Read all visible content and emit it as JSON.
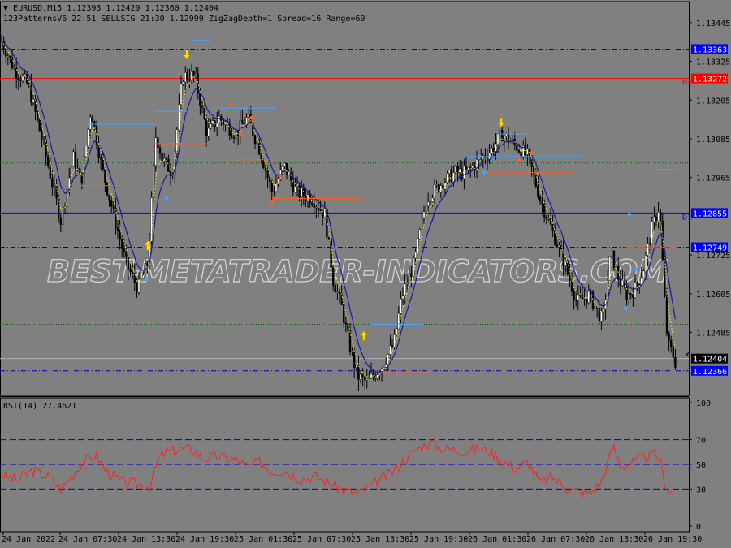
{
  "header": {
    "symbol_line": "EURUSD,M15  1.12393 1.12429 1.12360 1.12404",
    "indicator_line": "123PatternsV6  22:51  SELLSIG  21:30  1.12999  ZigZagDepth=1  Spread=16  Range=69"
  },
  "watermark": "BEST-METATRADER-INDICATORS.COM",
  "colors": {
    "background": "#808080",
    "bull_candle": "#ffffff",
    "bear_candle": "#000000",
    "rsi_line": "#ff2020",
    "ma_slow": "#1a1aa0",
    "ma_fast": "#f0e040",
    "level_blue": "#0000ff",
    "level_red": "#ff0000",
    "level_green": "#006000"
  },
  "price_axis": {
    "ticks": [
      "1.13445",
      "1.13325",
      "1.13205",
      "1.13085",
      "1.12965",
      "1.12725",
      "1.12605",
      "1.12485"
    ],
    "ymin": 1.1229,
    "ymax": 1.1351
  },
  "levels": [
    {
      "price": 1.13363,
      "label": "1.13363",
      "style": "dashdot",
      "color": "#0000c0",
      "box": "#0000ff"
    },
    {
      "price": 1.13272,
      "label": "1.13272",
      "style": "solid",
      "color": "#ff0000",
      "box": "#ff0000",
      "tag": "H4"
    },
    {
      "price": 1.12855,
      "label": "1.12855",
      "style": "solid",
      "color": "#0000ff",
      "box": "#0000ff",
      "tag": "D1"
    },
    {
      "price": 1.12749,
      "label": "1.12749",
      "style": "dashdot",
      "color": "#0000c0",
      "box": "#0000ff"
    },
    {
      "price": 1.12366,
      "label": "1.12366",
      "style": "dashdot",
      "color": "#0000c0",
      "box": "#0000ff"
    },
    {
      "price": 1.12404,
      "label": "1.12404",
      "style": "current",
      "color": "#b0b0b0",
      "box": "#000000"
    }
  ],
  "green_levels": [
    1.1301,
    1.1251
  ],
  "rsi": {
    "label": "RSI(14) 27.4621",
    "levels": [
      70,
      50,
      30
    ],
    "ticks": [
      "100",
      "70",
      "50",
      "30",
      "0"
    ]
  },
  "time_axis": [
    "24 Jan 2022",
    "24 Jan 07:30",
    "24 Jan 13:30",
    "24 Jan 19:30",
    "25 Jan 01:30",
    "25 Jan 07:30",
    "25 Jan 13:30",
    "25 Jan 19:30",
    "26 Jan 01:30",
    "26 Jan 07:30",
    "26 Jan 13:30",
    "26 Jan 19:30"
  ],
  "chart_data": {
    "type": "line",
    "anchors": [
      [
        0,
        1.134
      ],
      [
        18,
        1.133
      ],
      [
        35,
        1.1325
      ],
      [
        55,
        1.1305
      ],
      [
        75,
        1.1283
      ],
      [
        90,
        1.1303
      ],
      [
        100,
        1.1295
      ],
      [
        112,
        1.1318
      ],
      [
        125,
        1.13
      ],
      [
        140,
        1.1285
      ],
      [
        155,
        1.127
      ],
      [
        170,
        1.1262
      ],
      [
        182,
        1.127
      ],
      [
        192,
        1.131
      ],
      [
        200,
        1.1302
      ],
      [
        212,
        1.1298
      ],
      [
        225,
        1.1328
      ],
      [
        240,
        1.1328
      ],
      [
        255,
        1.131
      ],
      [
        270,
        1.1315
      ],
      [
        290,
        1.131
      ],
      [
        305,
        1.1315
      ],
      [
        320,
        1.1305
      ],
      [
        335,
        1.1292
      ],
      [
        350,
        1.13
      ],
      [
        365,
        1.1292
      ],
      [
        385,
        1.129
      ],
      [
        400,
        1.1285
      ],
      [
        410,
        1.1265
      ],
      [
        420,
        1.1257
      ],
      [
        430,
        1.1245
      ],
      [
        440,
        1.1235
      ],
      [
        452,
        1.1233
      ],
      [
        470,
        1.1238
      ],
      [
        485,
        1.1245
      ],
      [
        495,
        1.126
      ],
      [
        510,
        1.127
      ],
      [
        525,
        1.129
      ],
      [
        545,
        1.1295
      ],
      [
        560,
        1.1298
      ],
      [
        575,
        1.1298
      ],
      [
        590,
        1.1302
      ],
      [
        605,
        1.1305
      ],
      [
        618,
        1.131
      ],
      [
        632,
        1.1307
      ],
      [
        650,
        1.1303
      ],
      [
        665,
        1.129
      ],
      [
        680,
        1.128
      ],
      [
        695,
        1.127
      ],
      [
        710,
        1.1258
      ],
      [
        725,
        1.126
      ],
      [
        742,
        1.1252
      ],
      [
        752,
        1.1273
      ],
      [
        762,
        1.1265
      ],
      [
        772,
        1.126
      ],
      [
        782,
        1.1262
      ],
      [
        792,
        1.1268
      ],
      [
        802,
        1.128
      ],
      [
        812,
        1.1288
      ],
      [
        818,
        1.126
      ],
      [
        822,
        1.1245
      ],
      [
        828,
        1.1242
      ],
      [
        833,
        1.1238
      ]
    ],
    "rsi_anchors": [
      [
        0,
        43
      ],
      [
        20,
        37
      ],
      [
        40,
        45
      ],
      [
        60,
        40
      ],
      [
        75,
        30
      ],
      [
        85,
        38
      ],
      [
        100,
        50
      ],
      [
        118,
        58
      ],
      [
        130,
        45
      ],
      [
        150,
        36
      ],
      [
        170,
        34
      ],
      [
        185,
        32
      ],
      [
        195,
        55
      ],
      [
        205,
        60
      ],
      [
        220,
        62
      ],
      [
        235,
        63
      ],
      [
        250,
        55
      ],
      [
        270,
        56
      ],
      [
        290,
        54
      ],
      [
        305,
        48
      ],
      [
        320,
        52
      ],
      [
        335,
        44
      ],
      [
        350,
        45
      ],
      [
        370,
        38
      ],
      [
        390,
        40
      ],
      [
        405,
        35
      ],
      [
        420,
        30
      ],
      [
        440,
        26
      ],
      [
        455,
        32
      ],
      [
        470,
        38
      ],
      [
        485,
        45
      ],
      [
        500,
        55
      ],
      [
        515,
        63
      ],
      [
        530,
        68
      ],
      [
        545,
        63
      ],
      [
        560,
        62
      ],
      [
        575,
        60
      ],
      [
        590,
        63
      ],
      [
        605,
        60
      ],
      [
        620,
        52
      ],
      [
        635,
        46
      ],
      [
        650,
        52
      ],
      [
        665,
        35
      ],
      [
        680,
        40
      ],
      [
        695,
        32
      ],
      [
        710,
        28
      ],
      [
        725,
        26
      ],
      [
        740,
        35
      ],
      [
        755,
        65
      ],
      [
        765,
        48
      ],
      [
        775,
        50
      ],
      [
        790,
        55
      ],
      [
        805,
        58
      ],
      [
        812,
        55
      ],
      [
        818,
        36
      ],
      [
        824,
        28
      ],
      [
        830,
        27
      ]
    ]
  }
}
